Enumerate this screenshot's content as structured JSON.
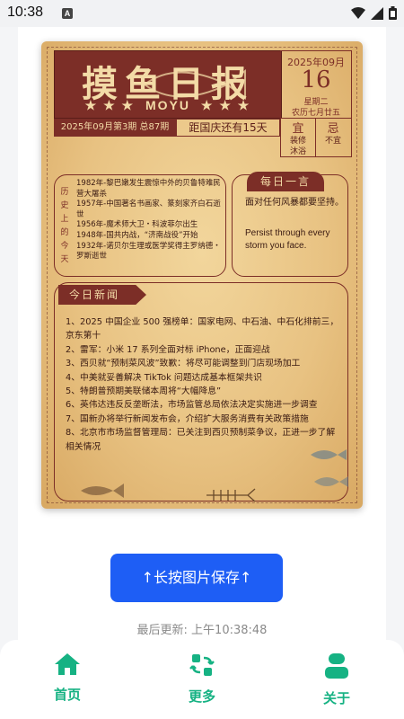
{
  "status_bar": {
    "time": "10:38",
    "notification_badge": "A",
    "icons": [
      "wifi-icon",
      "signal-icon",
      "battery-icon"
    ]
  },
  "newspaper": {
    "title": "摸鱼日报",
    "subtitle": "MOYU",
    "stars": "★ ★ ★",
    "date_year_month": "2025年09月",
    "date_day": "16",
    "weekday": "星期二",
    "lunar": "农历七月廿五",
    "issue": "2025年09月第3期 总87期",
    "countdown": "距国庆还有15天",
    "yi_label": "宜",
    "yi_items": "装修\n沐浴",
    "ji_label": "忌",
    "ji_items": "不宜",
    "history_label": "历史上的今天",
    "history": [
      "1982年-黎巴嫩发生震惊中外的贝鲁特难民营大屠杀",
      "1957年-中国著名书画家、篆刻家齐白石逝世",
      "1956年-魔术师大卫・科波菲尔出生",
      "1948年-国共内战，“济南战役”开始",
      "1932年-诺贝尔生理或医学奖得主罗纳德・罗斯逝世"
    ],
    "motto_title": "每日一言",
    "motto_cn": "面对任何风暴都要坚持。",
    "motto_en": "Persist through every storm you face.",
    "news_title": "今日新闻",
    "news": [
      "1、2025 中国企业 500 强榜单：国家电网、中石油、中石化排前三，京东第十",
      "2、雷军：小米 17 系列全面对标 iPhone，正面迎战",
      "3、西贝就“预制菜风波”致歉：将尽可能调整到门店现场加工",
      "4、中美就妥善解决 TikTok 问题达成基本框架共识",
      "5、特朗普预期美联储本周将“大幅降息”",
      "6、英伟达违反反垄断法，市场监管总局依法决定实施进一步调查",
      "7、国新办将举行新闻发布会，介绍扩大服务消费有关政策措施",
      "8、北京市市场监督管理局：已关注到西贝预制菜争议，正进一步了解相关情况"
    ]
  },
  "actions": {
    "save_label": "↑长按图片保存↑"
  },
  "last_updated": "最后更新: 上午10:38:48",
  "bottom_nav": [
    {
      "label": "首页",
      "icon": "home-icon"
    },
    {
      "label": "更多",
      "icon": "refresh-icon"
    },
    {
      "label": "关于",
      "icon": "user-icon"
    }
  ],
  "colors": {
    "accent": "#16b283",
    "primary_button": "#1e5ef5",
    "paper_red": "#7c2e27",
    "paper_bg": "#e8c282"
  }
}
